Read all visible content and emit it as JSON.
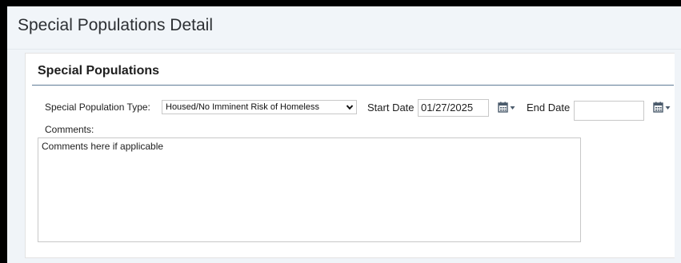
{
  "page": {
    "title": "Special Populations Detail"
  },
  "section": {
    "title": "Special Populations"
  },
  "form": {
    "type_label": "Special Population Type:",
    "type_value": "Housed/No Imminent Risk of Homeless",
    "start_label": "Start Date",
    "start_value": "01/27/2025",
    "end_label": "End Date",
    "end_value": "",
    "comments_label": "Comments:",
    "comments_value": "Comments here if applicable"
  },
  "icons": {
    "calendar": "calendar-icon",
    "dropdown": "caret-down-icon",
    "select_chevron": "chevron-down-icon"
  },
  "colors": {
    "header_bg": "#f1f5f9",
    "section_rule": "#5f7b96",
    "icon_color": "#4a5a6b"
  }
}
